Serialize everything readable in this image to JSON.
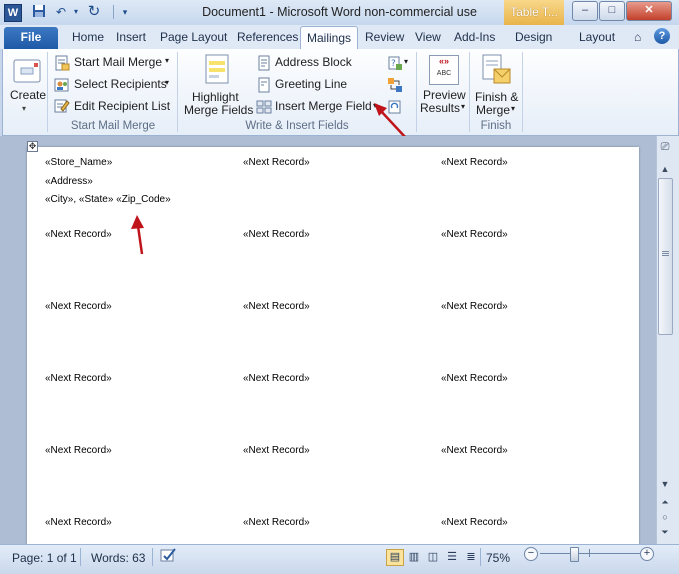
{
  "window": {
    "title": "Document1 - Microsoft Word non-commercial use",
    "contextual_tab": "Table T...",
    "buttons": {
      "minimize": "–",
      "maximize": "□",
      "close": "✕"
    }
  },
  "tabs": {
    "file": "File",
    "items": [
      "Home",
      "Insert",
      "Page Layout",
      "References",
      "Mailings",
      "Review",
      "View",
      "Add-Ins",
      "Design",
      "Layout"
    ],
    "active": "Mailings"
  },
  "ribbon": {
    "create": {
      "label": "Create"
    },
    "start_mail_merge": {
      "group_label": "Start Mail Merge",
      "start": "Start Mail Merge",
      "select": "Select Recipients",
      "edit": "Edit Recipient List"
    },
    "write_insert": {
      "group_label": "Write & Insert Fields",
      "highlight_1": "Highlight",
      "highlight_2": "Merge Fields",
      "address_block": "Address Block",
      "greeting_line": "Greeting Line",
      "insert_merge_field": "Insert Merge Field"
    },
    "preview": {
      "line1": "Preview",
      "line2": "Results",
      "icon_text": "«»\nABC"
    },
    "finish": {
      "group_label": "Finish",
      "line1": "Finish &",
      "line2": "Merge"
    }
  },
  "document": {
    "store_name": "«Store_Name»",
    "address": "«Address»",
    "city_state_zip": "«City», «State» «Zip_Code»",
    "next_record": "«Next Record»"
  },
  "status": {
    "page": "Page: 1 of 1",
    "words": "Words: 63",
    "zoom": "75%",
    "zoom_minus": "−",
    "zoom_plus": "+"
  },
  "colors": {
    "accent_red": "#c0141b",
    "file_tab": "#1f5aa8"
  }
}
